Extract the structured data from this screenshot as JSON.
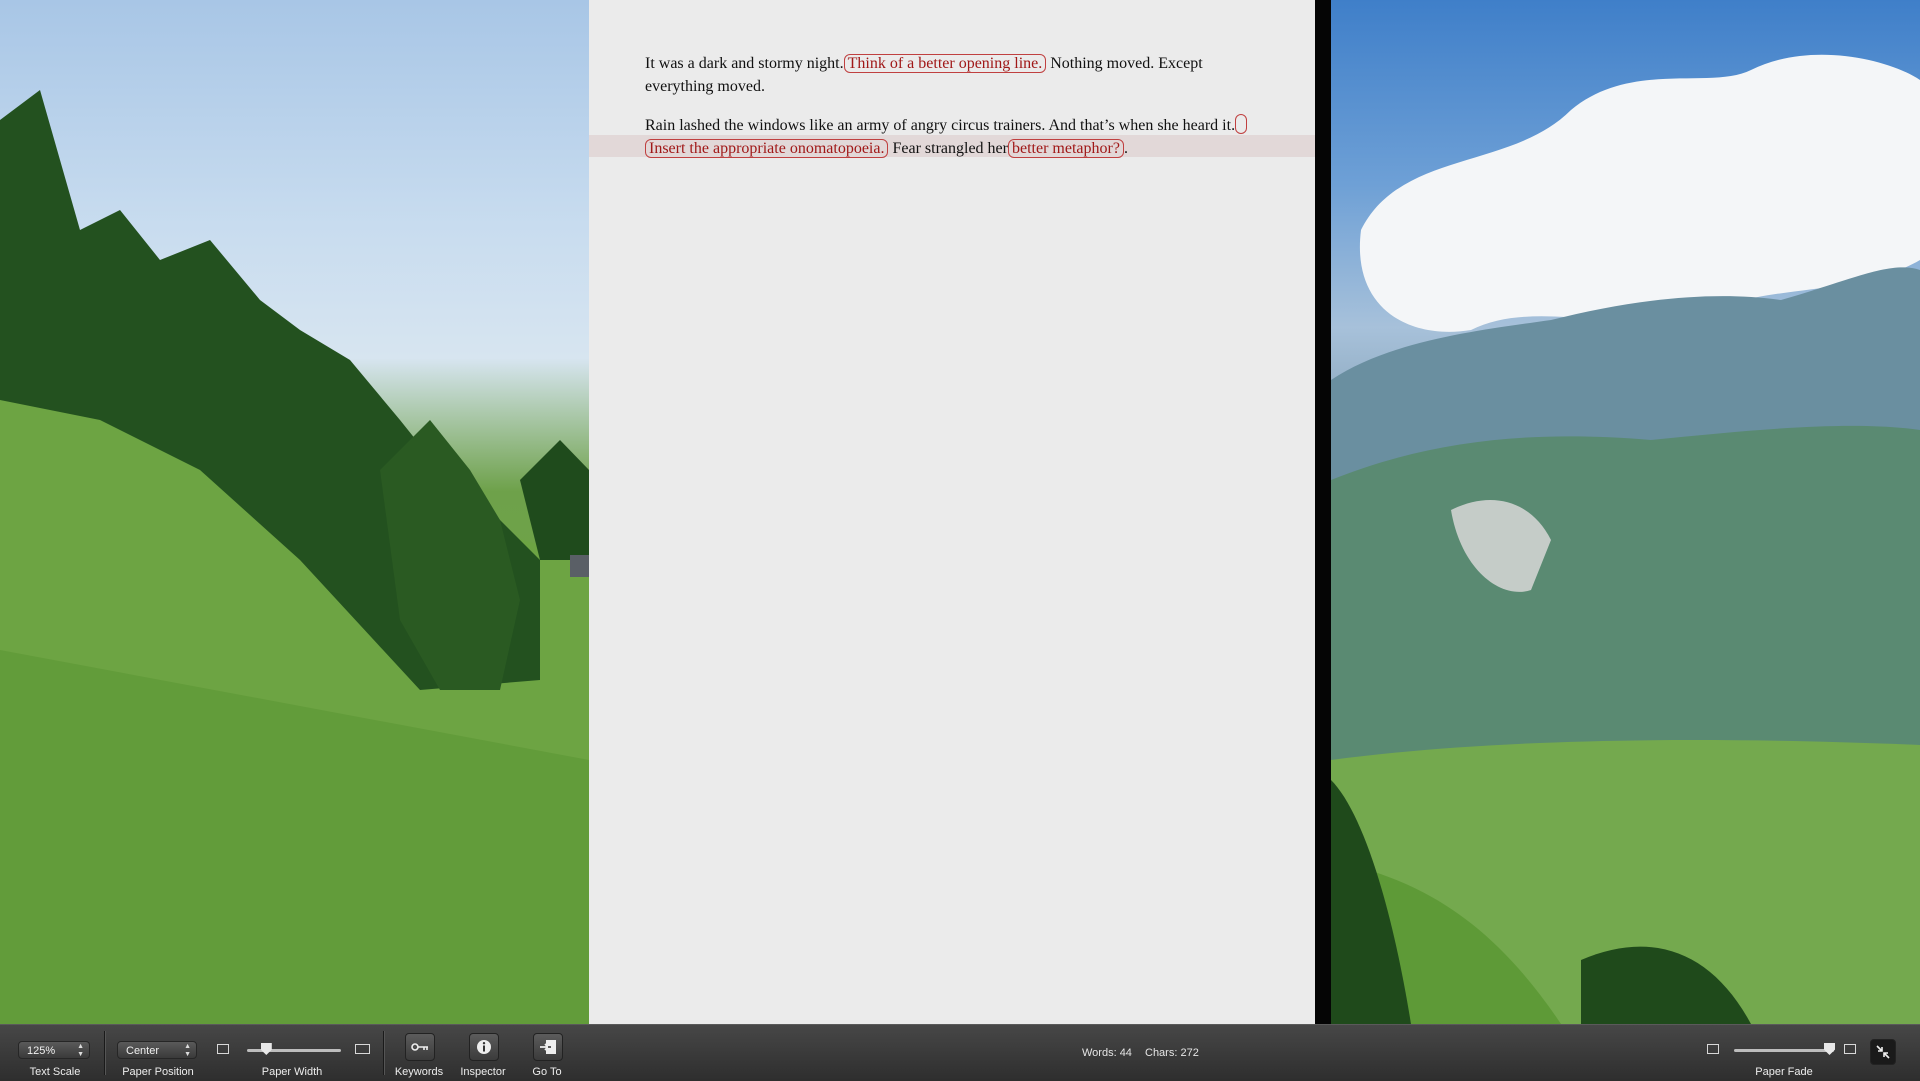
{
  "document": {
    "paragraphs": [
      {
        "text_1": "It was a dark and stormy night.",
        "annotation_1": "Think of a better opening line.",
        "text_2": " Nothing moved. Except everything moved."
      },
      {
        "text_1": "Rain lashed the windows like an army of angry circus trainers. And that’s when she heard it.",
        "annotation_1": "",
        "annotation_2": "Insert the appropriate onomatopoeia.",
        "text_2": " Fear strangled her",
        "annotation_3": "better metaphor?",
        "text_3": "."
      }
    ]
  },
  "toolbar": {
    "text_scale": {
      "value": "125%",
      "label": "Text Scale"
    },
    "paper_position": {
      "value": "Center",
      "label": "Paper Position"
    },
    "paper_width": {
      "label": "Paper Width",
      "level": 0.2
    },
    "keywords": {
      "label": "Keywords"
    },
    "inspector": {
      "label": "Inspector"
    },
    "goto": {
      "label": "Go To"
    },
    "stats": {
      "words": "Words: 44",
      "chars": "Chars: 272"
    },
    "paper_fade": {
      "label": "Paper Fade",
      "level": 0.95
    }
  },
  "icons": {
    "keywords": "key-icon",
    "inspector": "info-icon",
    "goto": "goto-icon",
    "exit": "exit-fullscreen-icon"
  }
}
